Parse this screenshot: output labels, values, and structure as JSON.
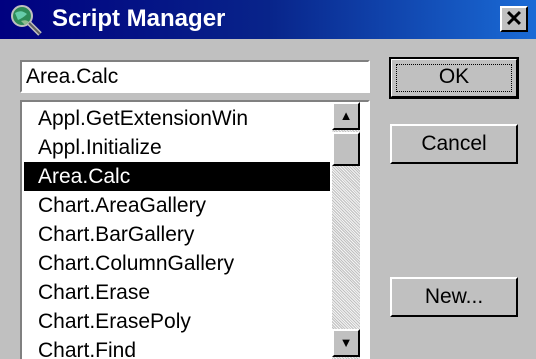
{
  "window": {
    "title": "Script Manager",
    "close_label": "✕"
  },
  "name_field": {
    "value": "Area.Calc"
  },
  "script_list": {
    "items": [
      {
        "label": "Appl.GetExtensionWin",
        "selected": false
      },
      {
        "label": "Appl.Initialize",
        "selected": false
      },
      {
        "label": "Area.Calc",
        "selected": true
      },
      {
        "label": "Chart.AreaGallery",
        "selected": false
      },
      {
        "label": "Chart.BarGallery",
        "selected": false
      },
      {
        "label": "Chart.ColumnGallery",
        "selected": false
      },
      {
        "label": "Chart.Erase",
        "selected": false
      },
      {
        "label": "Chart.ErasePoly",
        "selected": false
      },
      {
        "label": "Chart.Find",
        "selected": false
      }
    ],
    "scroll_up_glyph": "▲",
    "scroll_down_glyph": "▼"
  },
  "buttons": {
    "ok": "OK",
    "cancel": "Cancel",
    "new": "New..."
  }
}
